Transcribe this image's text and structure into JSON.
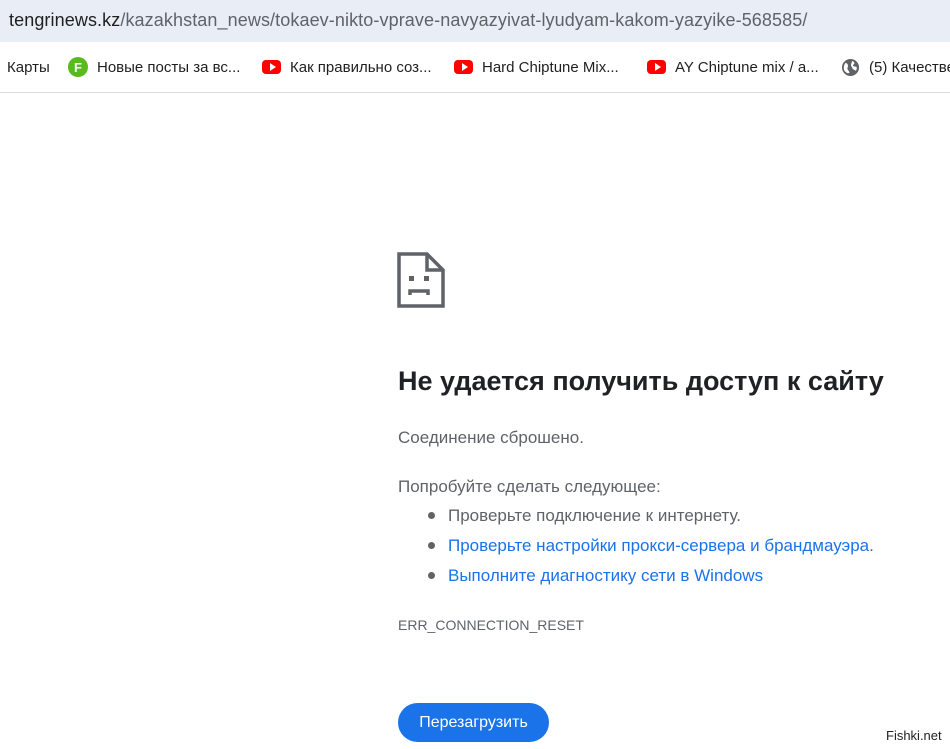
{
  "addressbar": {
    "url_host": "tengrinews.kz",
    "url_path": "/kazakhstan_news/tokaev-nikto-vprave-navyazyivat-lyudyam-kakom-yazyike-568585/"
  },
  "bookmarks": [
    {
      "label": "Карты",
      "icon": "none"
    },
    {
      "label": "Новые посты за вс...",
      "icon": "fishki-f-icon"
    },
    {
      "label": "Как правильно соз...",
      "icon": "youtube-icon"
    },
    {
      "label": "Hard Chiptune Mix...",
      "icon": "youtube-icon"
    },
    {
      "label": "AY Chiptune mix / a...",
      "icon": "youtube-icon"
    },
    {
      "label": "(5) Качестве",
      "icon": "globe-icon"
    }
  ],
  "error": {
    "title": "Не удается получить доступ к сайту",
    "message": "Соединение сброшено.",
    "try_heading": "Попробуйте сделать следующее:",
    "suggestions": [
      {
        "text": "Проверьте подключение к интернету.",
        "is_link": false
      },
      {
        "text": "Проверьте настройки прокси-сервера и брандмауэра",
        "is_link": true,
        "trailing": "."
      },
      {
        "text": "Выполните диагностику сети в Windows",
        "is_link": true
      }
    ],
    "code": "ERR_CONNECTION_RESET",
    "reload_label": "Перезагрузить"
  },
  "watermark": "Fishki.net",
  "colors": {
    "accent": "#1a73e8",
    "addressbar_bg": "#e9eef6",
    "secondary_text": "#5f6368"
  }
}
